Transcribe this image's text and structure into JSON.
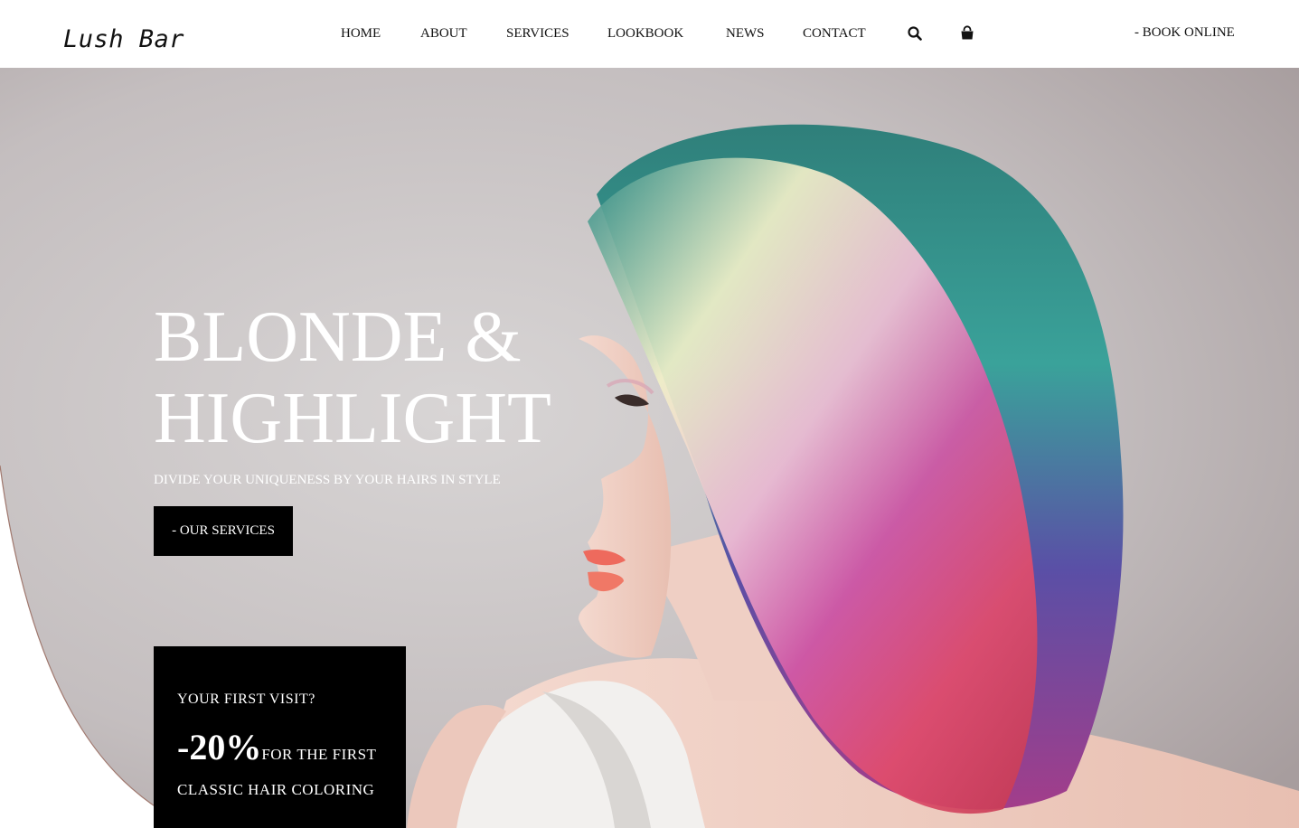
{
  "header": {
    "logo": "Lush Bar",
    "nav": [
      {
        "label": "HOME"
      },
      {
        "label": "ABOUT"
      },
      {
        "label": "SERVICES"
      },
      {
        "label": "LOOKBOOK"
      },
      {
        "label": "NEWS"
      },
      {
        "label": "CONTACT"
      }
    ],
    "icons": [
      "search-icon",
      "shopping-bag-icon"
    ],
    "book_online": "- BOOK ONLINE"
  },
  "hero": {
    "title_line1": "BLONDE &",
    "title_line2": "HIGHLIGHT",
    "subtitle": "DIVIDE YOUR UNIQUENESS BY YOUR HAIRS IN STYLE",
    "button_label": "- OUR SERVICES"
  },
  "promo": {
    "heading": "YOUR FIRST VISIT?",
    "discount": "-20%",
    "text_line1": "FOR THE FIRST",
    "text_line2": "CLASSIC HAIR COLORING"
  },
  "colors": {
    "text": "#111111",
    "dark_block": "#000000",
    "hero_text": "#ffffff",
    "background_grey": "#c9c4c4"
  }
}
